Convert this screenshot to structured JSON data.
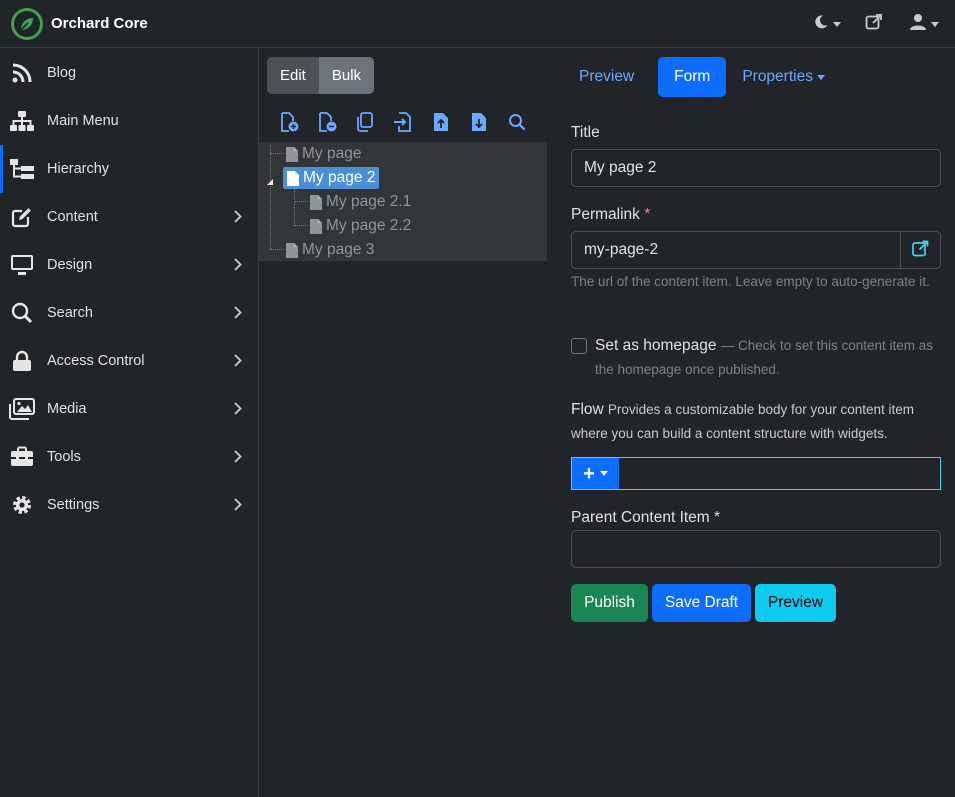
{
  "brand": {
    "name": "Orchard Core",
    "color": "#3fa14b"
  },
  "topbar": {
    "icons": [
      "moon-icon",
      "external-link-icon",
      "user-icon"
    ]
  },
  "sidebar": {
    "items": [
      {
        "label": "Blog",
        "icon": "rss-icon",
        "chevron": false,
        "active": false
      },
      {
        "label": "Main Menu",
        "icon": "sitemap-icon",
        "chevron": false,
        "active": false
      },
      {
        "label": "Hierarchy",
        "icon": "hierarchy-icon",
        "chevron": false,
        "active": true
      },
      {
        "label": "Content",
        "icon": "edit-icon",
        "chevron": true,
        "active": false
      },
      {
        "label": "Design",
        "icon": "monitor-icon",
        "chevron": true,
        "active": false
      },
      {
        "label": "Search",
        "icon": "search-icon",
        "chevron": true,
        "active": false
      },
      {
        "label": "Access Control",
        "icon": "lock-icon",
        "chevron": true,
        "active": false
      },
      {
        "label": "Media",
        "icon": "images-icon",
        "chevron": true,
        "active": false
      },
      {
        "label": "Tools",
        "icon": "toolbox-icon",
        "chevron": true,
        "active": false
      },
      {
        "label": "Settings",
        "icon": "gear-icon",
        "chevron": true,
        "active": false
      }
    ]
  },
  "tree_panel": {
    "edit_label": "Edit",
    "bulk_label": "Bulk",
    "toolbar_icons": [
      "add-file-icon",
      "remove-file-icon",
      "copy-icon",
      "move-icon",
      "upload-icon",
      "download-icon",
      "search-icon"
    ],
    "nodes": [
      {
        "label": "My page",
        "level": 0,
        "selected": false
      },
      {
        "label": "My page 2",
        "level": 0,
        "selected": true
      },
      {
        "label": "My page 2.1",
        "level": 1,
        "selected": false
      },
      {
        "label": "My page 2.2",
        "level": 1,
        "selected": false
      },
      {
        "label": "My page 3",
        "level": 0,
        "selected": false
      }
    ]
  },
  "form": {
    "tabs": {
      "preview": "Preview",
      "form": "Form",
      "properties": "Properties"
    },
    "title_label": "Title",
    "title_value": "My page 2",
    "permalink_label": "Permalink",
    "required_mark": "*",
    "permalink_value": "my-page-2",
    "permalink_hint": "The url of the content item. Leave empty to auto-generate it.",
    "homepage_label": "Set as homepage",
    "homepage_desc": "— Check to set this content item as the homepage once published.",
    "flow_label": "Flow",
    "flow_desc": "Provides a customizable body for your content item where you can build a content structure with widgets.",
    "flow_add": "+",
    "parent_label": "Parent Content Item *",
    "parent_value": "",
    "buttons": {
      "publish": "Publish",
      "save_draft": "Save Draft",
      "preview": "Preview"
    }
  },
  "colors": {
    "primary": "#0d6efd",
    "success": "#198754",
    "info": "#0dcaf0",
    "selected_node": "#4d8fd6"
  }
}
